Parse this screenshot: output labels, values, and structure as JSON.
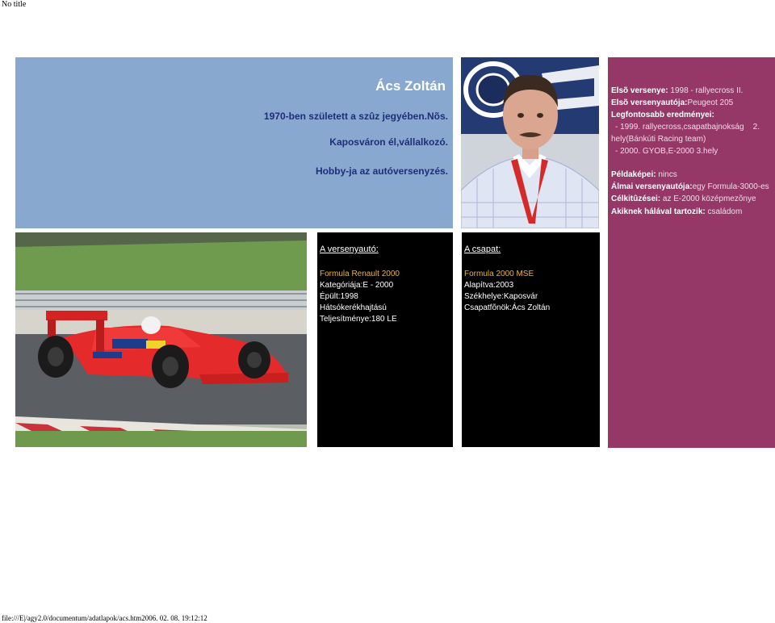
{
  "window": {
    "title": "No title"
  },
  "profile": {
    "name": "Ács Zoltán",
    "lines": [
      "1970-ben született a szûz jegyében.Nõs.",
      "Kaposváron él,vállalkozó.",
      "Hobby-ja az autóversenyzés."
    ]
  },
  "details": {
    "first_race_label": "Elsõ versenye:",
    "first_race_value": " 1998 - rallyecross II.",
    "first_car_label": "Elsõ versenyautója:",
    "first_car_value": "Peugeot 205",
    "best_results_label": "Legfontosabb eredményei:",
    "result_1a": "- 1999. rallyecross,csapatbajnokság    2.",
    "result_1b": "hely(Bánkúti Racing team)",
    "result_2": "- 2000. GYOB,E-2000 3.hely",
    "idols_label": "Példaképei:",
    "idols_value": " nincs",
    "dream_car_label": "Álmai versenyautója:",
    "dream_car_value": "egy Formula-3000-es",
    "goals_label": "Célkitûzései:",
    "goals_value": " az E-2000 középmezõnye",
    "thanks_label": "Akiknek hálával tartozik:",
    "thanks_value": " családom"
  },
  "car": {
    "heading": "A versenyautó:",
    "model": "Formula Renault 2000",
    "category": "Kategóriája:E - 2000",
    "built": "Épült:1998",
    "drive": "Hátsókerékhajtású",
    "power": "Teljesítménye:180 LE"
  },
  "team": {
    "heading": "A csapat:",
    "name": "Formula 2000 MSE",
    "founded": "Alapítva:2003",
    "seat": "Székhelye:Kaposvár",
    "chief": "Csapatfõnök:Ács Zoltán"
  },
  "footer": {
    "path": "file:///E|/agy2.0/documentum/adatlapok/acs.htm2006. 02. 08. 19:12:12"
  },
  "colors": {
    "blue_panel": "#88a8d0",
    "purple_panel": "#953868",
    "black_box": "#000000",
    "highlight": "#f0b42c",
    "dark_blue_text": "#1c2f78"
  }
}
